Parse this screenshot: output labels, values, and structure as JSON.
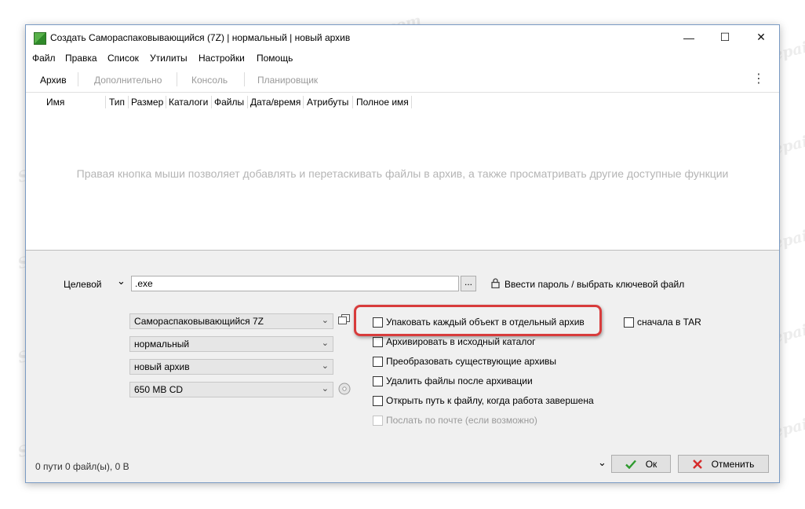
{
  "window": {
    "title": "Создать Самораспаковывающийся (7Z) | нормальный | новый архив",
    "controls": {
      "minimize": "—",
      "maximize": "☐",
      "close": "✕"
    }
  },
  "menu": [
    "Файл",
    "Правка",
    "Список",
    "Утилиты",
    "Настройки",
    "Помощь"
  ],
  "tabs": [
    {
      "label": "Архив",
      "active": true
    },
    {
      "label": "Дополнительно",
      "active": false
    },
    {
      "label": "Консоль",
      "active": false
    },
    {
      "label": "Планировщик",
      "active": false
    }
  ],
  "kebab": "⋮",
  "file_list": {
    "columns": [
      "Имя",
      "Тип",
      "Размер",
      "Каталоги",
      "Файлы",
      "Дата/время",
      "Атрибуты",
      "Полное имя"
    ],
    "empty_hint": "Правая кнопка мыши позволяет добавлять и перетаскивать файлы в архив, а также просматривать другие доступные функции"
  },
  "target": {
    "label": "Целевой",
    "toggle": "⌄",
    "value": ".exe",
    "browse_label": "...",
    "password_label": "Ввести пароль / выбрать ключевой файл"
  },
  "combos": {
    "format": "Самораспаковывающийся 7Z",
    "level": "нормальный",
    "mode": "новый архив",
    "split": "650 MB CD"
  },
  "options": [
    {
      "label": "Упаковать каждый объект в отдельный архив",
      "checked": false,
      "disabled": false
    },
    {
      "label": "Архивировать в исходный каталог",
      "checked": false,
      "disabled": false
    },
    {
      "label": "Преобразовать существующие архивы",
      "checked": false,
      "disabled": false
    },
    {
      "label": "Удалить файлы после архивации",
      "checked": false,
      "disabled": false
    },
    {
      "label": "Открыть путь к файлу, когда работа завершена",
      "checked": false,
      "disabled": false
    },
    {
      "label": "Послать по почте (если возможно)",
      "checked": false,
      "disabled": true
    }
  ],
  "tar_option": {
    "label": "сначала в TAR",
    "checked": false
  },
  "status": "0 пути 0 файл(ы), 0 B",
  "buttons": {
    "ok": "Ок",
    "cancel": "Отменить"
  },
  "watermark": "Soringpcrepair.com",
  "colors": {
    "highlight": "#d83c3c",
    "ok_check": "#2e9a2e",
    "cancel_x": "#d62b2b"
  }
}
